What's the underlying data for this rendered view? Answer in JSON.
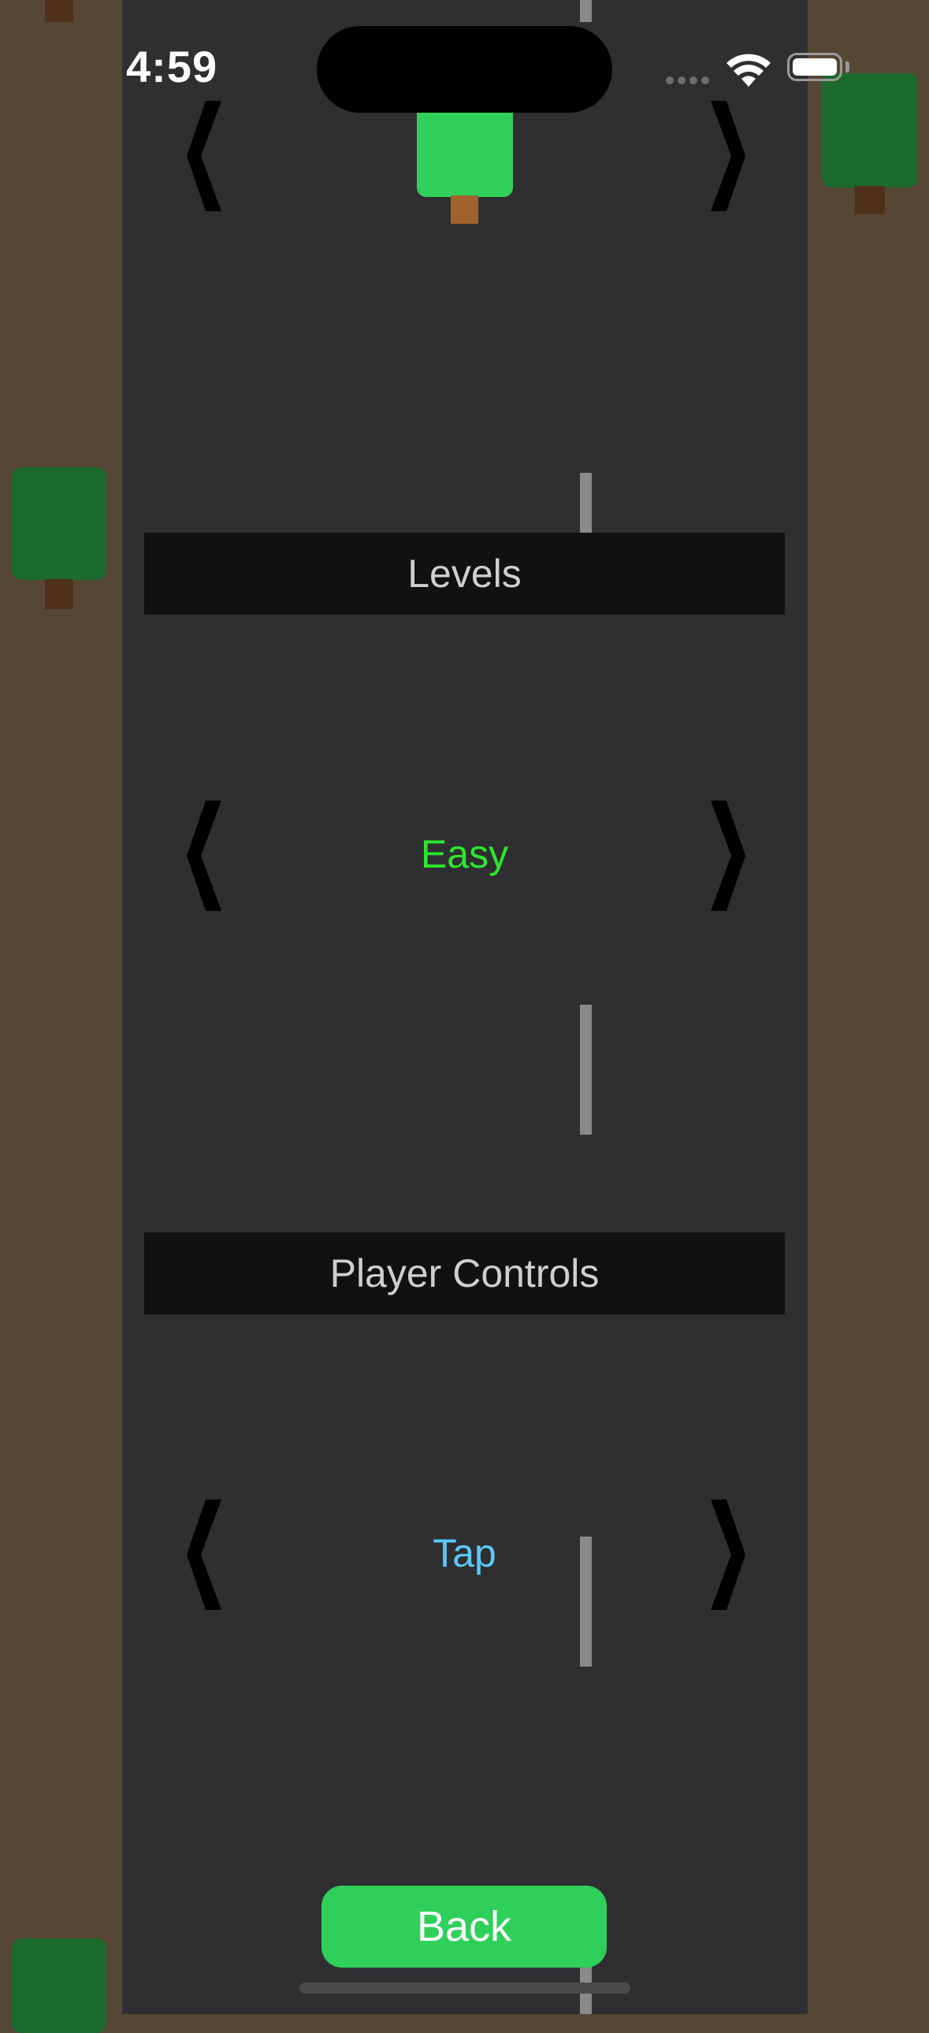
{
  "status_bar": {
    "time": "4:59",
    "icons": [
      "signal-dots-icon",
      "wifi-icon",
      "battery-icon"
    ]
  },
  "levels": {
    "header": "Levels",
    "value": "Easy",
    "value_color": "#2ee62e",
    "prev_icon": "chevron-left-icon",
    "next_icon": "chevron-right-icon"
  },
  "player_controls": {
    "header": "Player Controls",
    "value": "Tap",
    "value_color": "#5ac8fa",
    "prev_icon": "chevron-left-icon",
    "next_icon": "chevron-right-icon"
  },
  "top_selector": {
    "prev_icon": "chevron-left-icon",
    "next_icon": "chevron-right-icon"
  },
  "back_button": {
    "label": "Back"
  },
  "colors": {
    "road": "#2f2f31",
    "roadside": "#564634",
    "button_green": "#2fd05a",
    "tree_crown": "#1c6b2c",
    "car_green": "#30d15a"
  }
}
